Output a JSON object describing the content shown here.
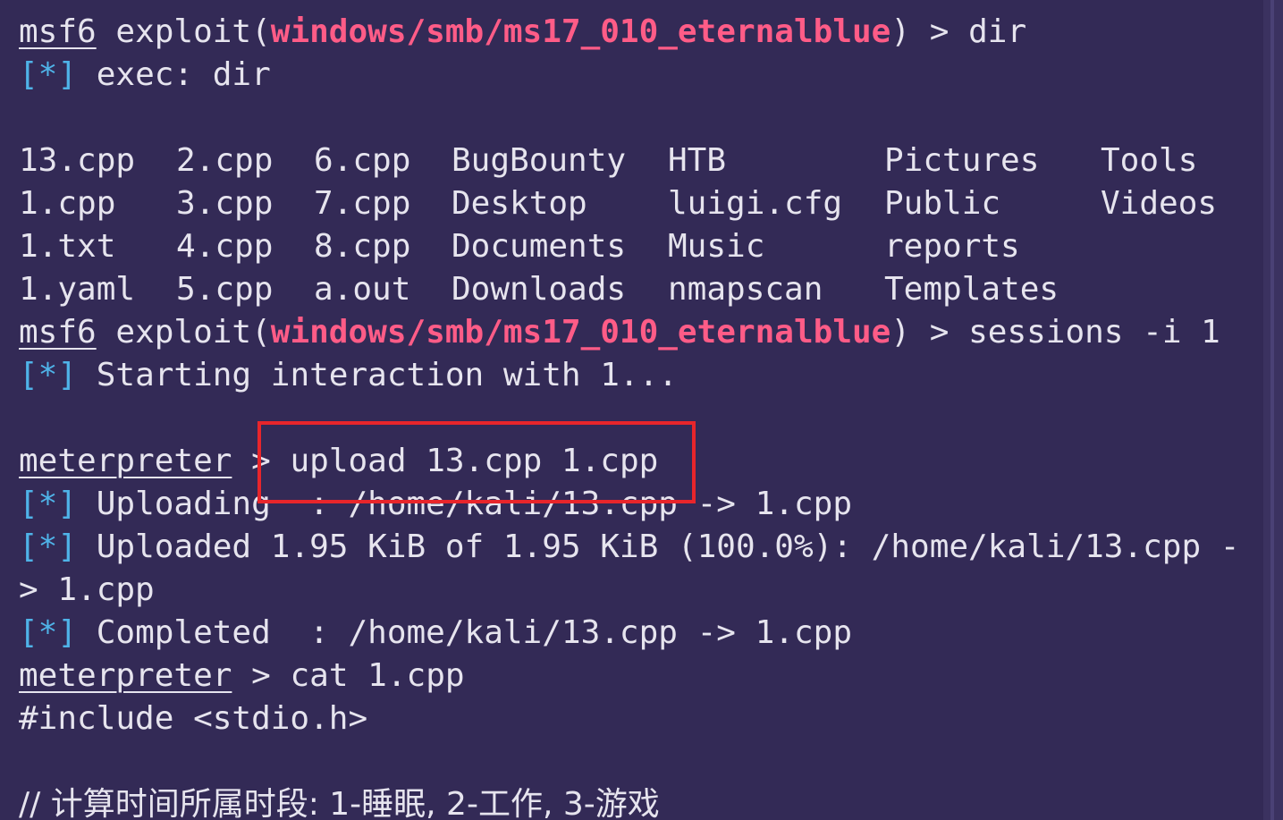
{
  "colors": {
    "background": "#332a56",
    "text": "#e6e4ee",
    "module": "#ff5c87",
    "status_marker": "#4fb3e8",
    "highlight_box": "#e8252b"
  },
  "prompt_msf": "msf6",
  "exploit_word": "exploit(",
  "module_path": "windows/smb/ms17_010_eternalblue",
  "close_paren": ")",
  "prompt_arrow": ">",
  "status_marker": "[*]",
  "commands": {
    "dir": "dir",
    "sessions": "sessions -i 1",
    "upload": "upload 13.cpp 1.cpp",
    "cat": "cat 1.cpp"
  },
  "messages": {
    "exec": "exec: dir",
    "starting": "Starting interaction with 1...",
    "uploading": "Uploading  : /home/kali/13.cpp -> 1.cpp",
    "uploaded": "Uploaded 1.95 KiB of 1.95 KiB (100.0%): /home/kali/13.cpp -",
    "uploaded_wrap": "> 1.cpp",
    "completed": "Completed  : /home/kali/13.cpp -> 1.cpp"
  },
  "meterpreter_prompt": "meterpreter",
  "dir_listing": [
    [
      "13.cpp",
      "2.cpp",
      "6.cpp",
      "BugBounty",
      "HTB",
      "Pictures",
      "Tools"
    ],
    [
      "1.cpp",
      "3.cpp",
      "7.cpp",
      "Desktop",
      "luigi.cfg",
      "Public",
      "Videos"
    ],
    [
      "1.txt",
      "4.cpp",
      "8.cpp",
      "Documents",
      "Music",
      "reports",
      ""
    ],
    [
      "1.yaml",
      "5.cpp",
      "a.out",
      "Downloads",
      "nmapscan",
      "Templates",
      ""
    ]
  ],
  "file_content": {
    "include": "#include <stdio.h>",
    "comment": "// 计算时间所属时段: 1-睡眠, 2-工作, 3-游戏"
  }
}
